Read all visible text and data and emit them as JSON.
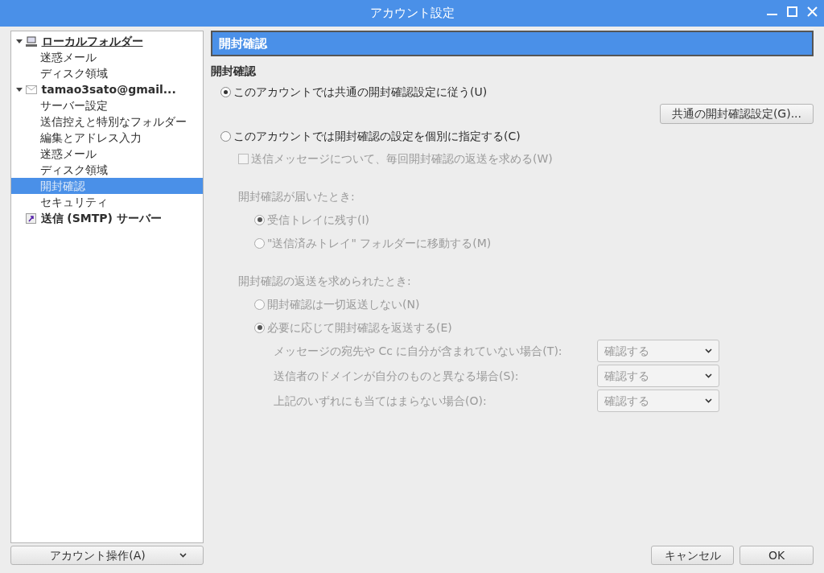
{
  "window": {
    "title": "アカウント設定"
  },
  "tree": [
    {
      "label": "ローカルフォルダー",
      "kind": "local",
      "bold": true,
      "underline": true,
      "expanded": true,
      "selected": false,
      "children": [
        {
          "label": "迷惑メール",
          "selected": false
        },
        {
          "label": "ディスク領域",
          "selected": false
        }
      ]
    },
    {
      "label": "tamao3sato@gmail...",
      "kind": "mail",
      "bold": true,
      "underline": false,
      "expanded": true,
      "selected": false,
      "children": [
        {
          "label": "サーバー設定",
          "selected": false
        },
        {
          "label": "送信控えと特別なフォルダー",
          "selected": false
        },
        {
          "label": "編集とアドレス入力",
          "selected": false
        },
        {
          "label": "迷惑メール",
          "selected": false
        },
        {
          "label": "ディスク領域",
          "selected": false
        },
        {
          "label": "開封確認",
          "selected": true
        },
        {
          "label": "セキュリティ",
          "selected": false
        }
      ]
    },
    {
      "label": "送信 (SMTP) サーバー",
      "kind": "smtp",
      "bold": true,
      "underline": false,
      "selected": false
    }
  ],
  "account_actions": {
    "label": "アカウント操作(A)"
  },
  "panel": {
    "header": "開封確認",
    "section_title": "開封確認",
    "global_option": {
      "label": "このアカウントでは共通の開封確認設定に従う(U)",
      "selected": true,
      "disabled": false
    },
    "global_button": {
      "label": "共通の開封確認設定(G)...",
      "disabled": false
    },
    "custom_option": {
      "label": "このアカウントでは開封確認の設定を個別に指定する(C)",
      "selected": false,
      "disabled": false
    },
    "request_checkbox": {
      "label": "送信メッセージについて、毎回開封確認の返送を求める(W)",
      "checked": false,
      "disabled": true
    },
    "arrival": {
      "title": "開封確認が届いたとき:",
      "options": [
        {
          "label": "受信トレイに残す(I)",
          "selected": true,
          "disabled": true
        },
        {
          "label": "\"送信済みトレイ\" フォルダーに移動する(M)",
          "selected": false,
          "disabled": true
        }
      ]
    },
    "requested": {
      "title": "開封確認の返送を求められたとき:",
      "options": [
        {
          "label": "開封確認は一切返送しない(N)",
          "selected": false,
          "disabled": true
        },
        {
          "label": "必要に応じて開封確認を返送する(E)",
          "selected": true,
          "disabled": true
        }
      ],
      "rules": [
        {
          "label": "メッセージの宛先や Cc に自分が含まれていない場合(T):",
          "value": "確認する",
          "disabled": true
        },
        {
          "label": "送信者のドメインが自分のものと異なる場合(S):",
          "value": "確認する",
          "disabled": true
        },
        {
          "label": "上記のいずれにも当てはまらない場合(O):",
          "value": "確認する",
          "disabled": true
        }
      ]
    }
  },
  "buttons": [
    {
      "label": "キャンセル"
    },
    {
      "label": "OK"
    }
  ]
}
